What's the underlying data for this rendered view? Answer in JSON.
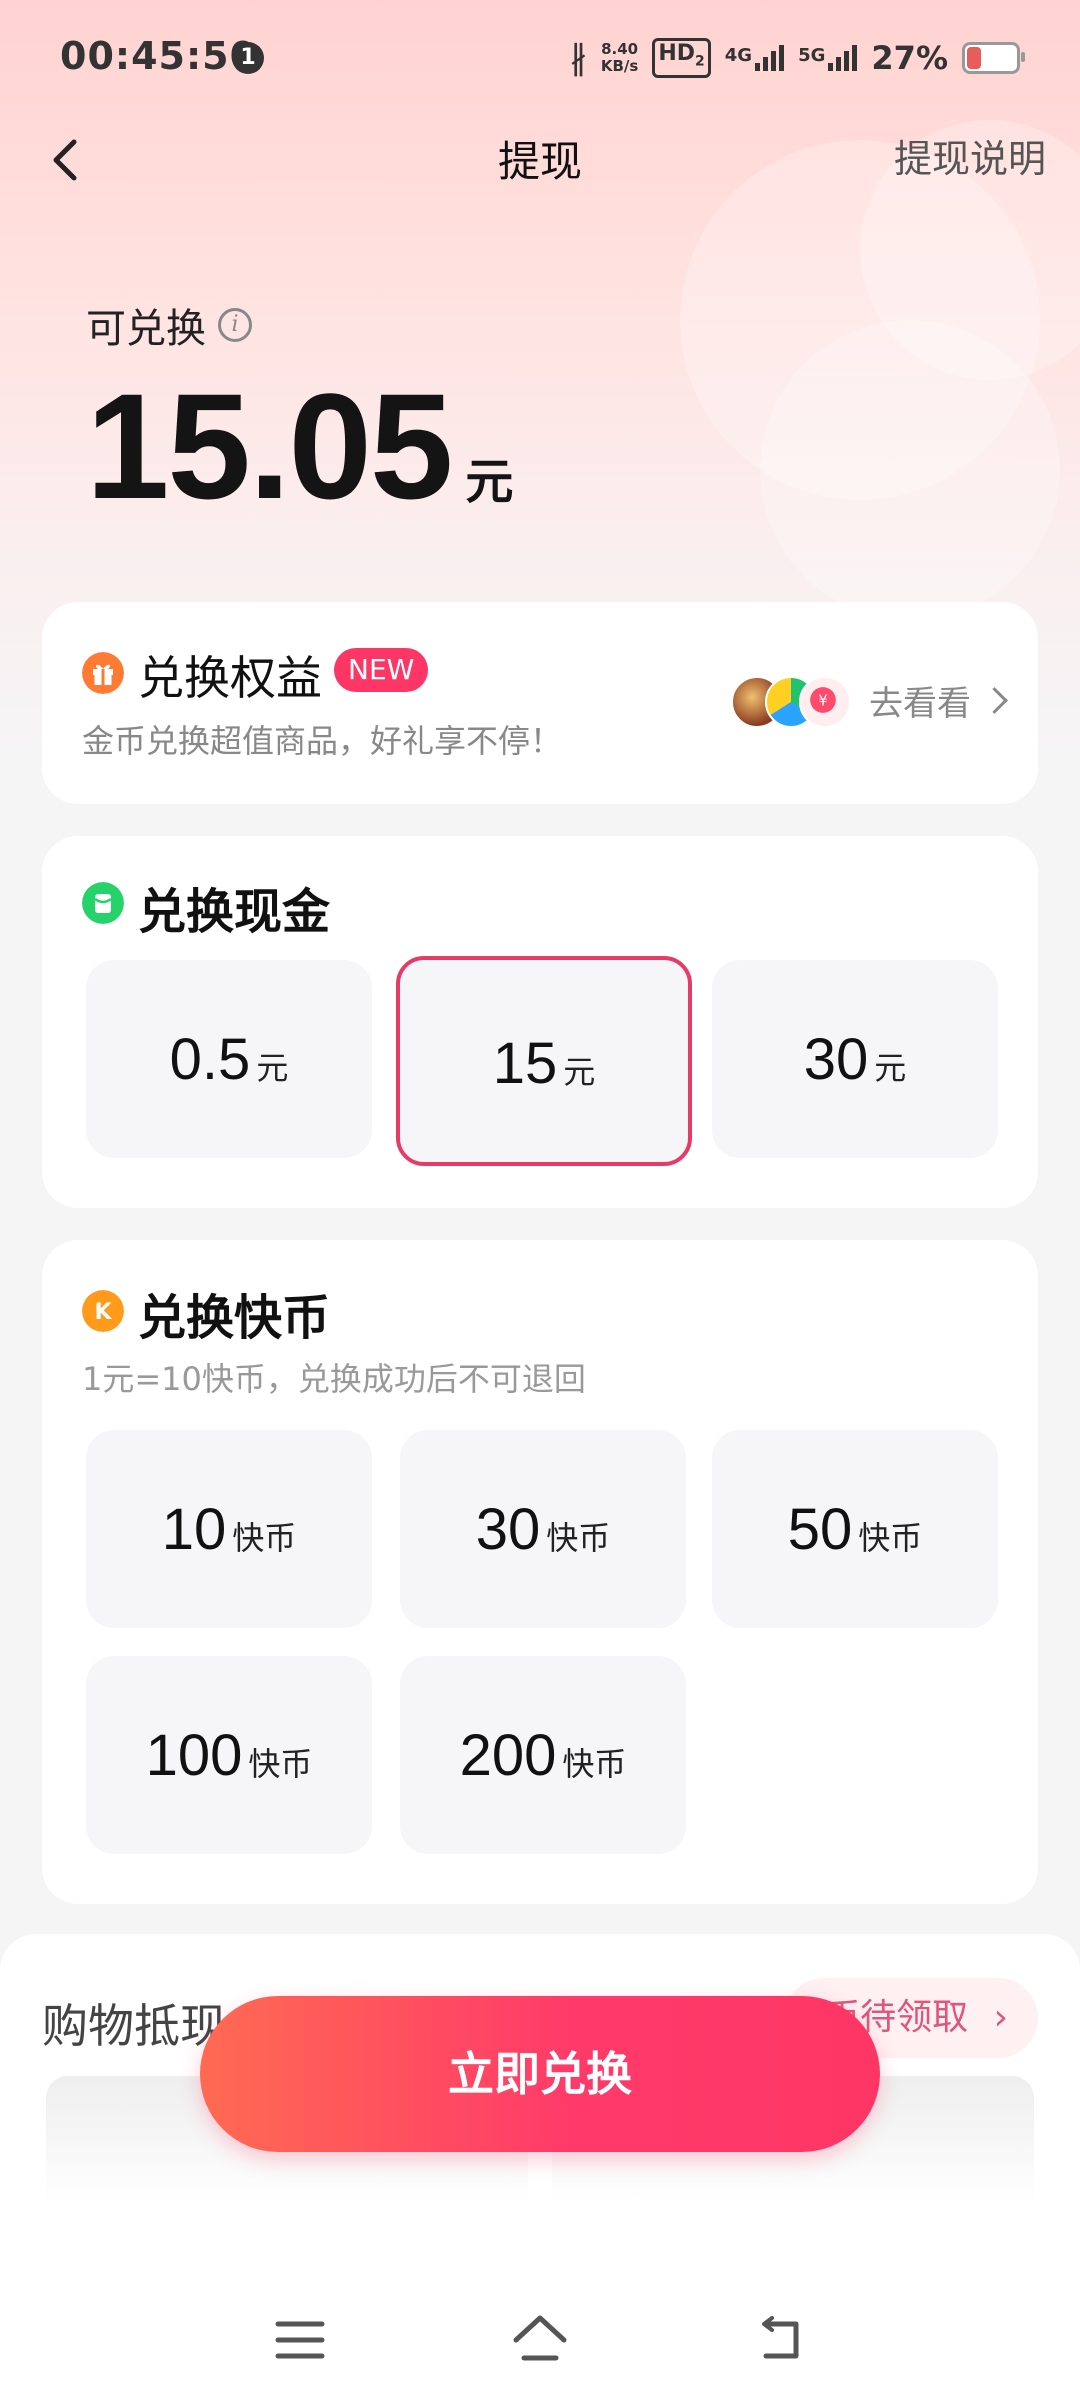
{
  "status_bar": {
    "time": "00:45:50",
    "notification_count": "1",
    "net_speed_value": "8.40",
    "net_speed_unit": "KB/s",
    "hd_label": "HD",
    "hd_sub": "2",
    "net1": "4G",
    "net2": "5G",
    "battery_pct": "27%",
    "battery_level": 0.27
  },
  "nav": {
    "title": "提现",
    "right_link": "提现说明"
  },
  "balance": {
    "label": "可兑换",
    "amount": "15.05",
    "unit": "元"
  },
  "benefit": {
    "title": "兑换权益",
    "badge": "NEW",
    "subtitle": "金币兑换超值商品，好礼享不停！",
    "link": "去看看"
  },
  "cash": {
    "title": "兑换现金",
    "options": [
      {
        "value": "0.5",
        "unit": "元",
        "selected": false
      },
      {
        "value": "15",
        "unit": "元",
        "selected": true
      },
      {
        "value": "30",
        "unit": "元",
        "selected": false
      }
    ]
  },
  "coins": {
    "title": "兑换快币",
    "subtitle": "1元=10快币，兑换成功后不可退回",
    "options": [
      {
        "value": "10",
        "unit": "快币"
      },
      {
        "value": "30",
        "unit": "快币"
      },
      {
        "value": "50",
        "unit": "快币"
      },
      {
        "value": "100",
        "unit": "快币"
      },
      {
        "value": "200",
        "unit": "快币"
      }
    ]
  },
  "shopping": {
    "title": "购物抵现",
    "pill": "币待领取"
  },
  "cta": {
    "label": "立即兑换"
  },
  "colors": {
    "accent": "#fe3666",
    "selected_border": "#e83a66"
  }
}
